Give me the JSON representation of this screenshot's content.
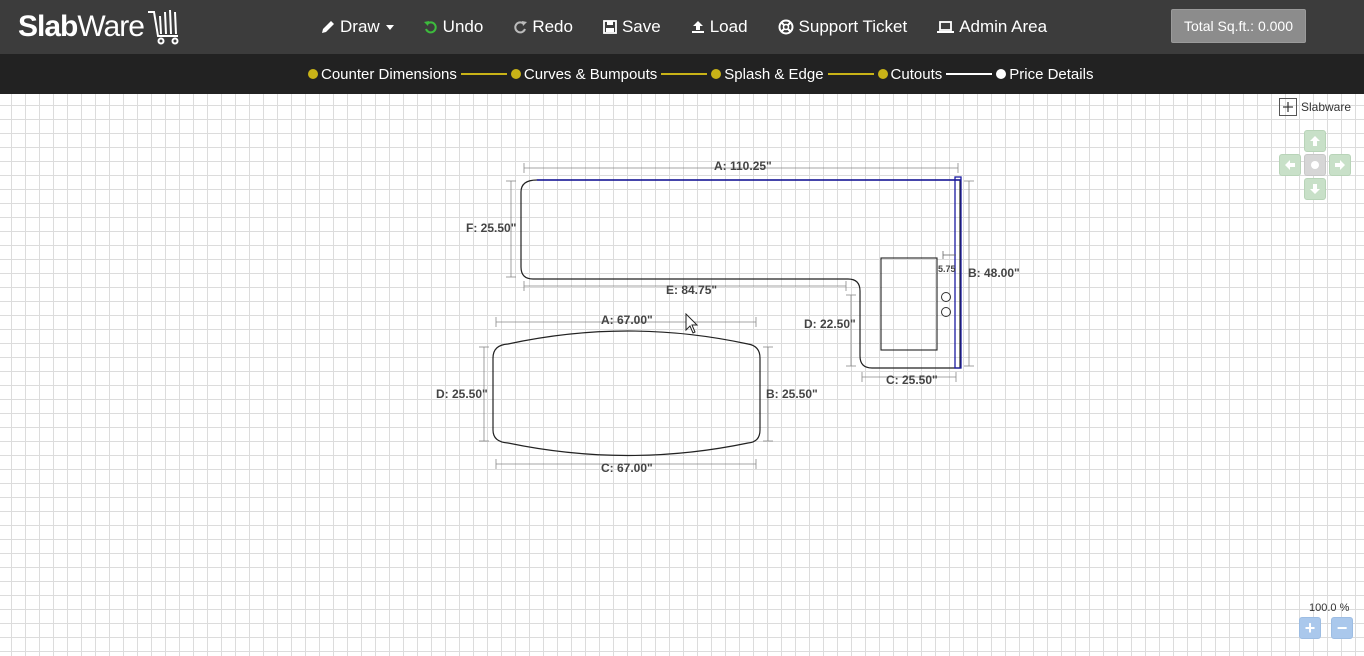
{
  "app": {
    "logo_part1": "Slab",
    "logo_part2": "Ware"
  },
  "nav": {
    "draw": "Draw",
    "undo": "Undo",
    "redo": "Redo",
    "save": "Save",
    "load": "Load",
    "support": "Support Ticket",
    "admin": "Admin Area"
  },
  "total": "Total Sq.ft.: 0.000",
  "steps": [
    {
      "label": "Counter Dimensions"
    },
    {
      "label": "Curves & Bumpouts"
    },
    {
      "label": "Splash & Edge"
    },
    {
      "label": "Cutouts"
    },
    {
      "label": "Price Details"
    }
  ],
  "shapes": {
    "l_top": "A: 110.25\"",
    "l_left": "F: 25.50\"",
    "l_inner_bottom": "E: 84.75\"",
    "l_right": "B: 48.00\"",
    "l_inner_vertical": "D: 22.50\"",
    "l_bottom": "C: 25.50\"",
    "sink_offset": "5.75",
    "island_top": "A: 67.00\"",
    "island_left": "D: 25.50\"",
    "island_right": "B: 25.50\"",
    "island_bottom": "C: 67.00\""
  },
  "brand_tag": "Slabware",
  "zoom": {
    "level": "100.0 %",
    "plus": "+",
    "minus": "−"
  },
  "colors": {
    "topbar": "#3c3c3c",
    "stepbar": "#222222",
    "step_dot": "#c9b317",
    "edge_highlight": "#1a1aa0"
  }
}
